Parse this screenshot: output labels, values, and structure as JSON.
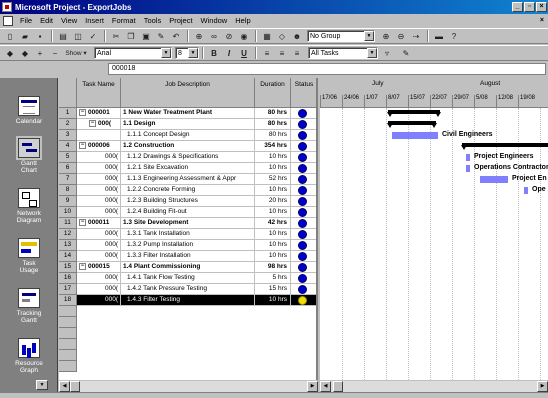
{
  "window": {
    "title": "Microsoft Project - ExportJobs",
    "minimize": "_",
    "maximize": "▫",
    "close": "×"
  },
  "menu": {
    "items": [
      {
        "label": "File"
      },
      {
        "label": "Edit"
      },
      {
        "label": "View"
      },
      {
        "label": "Insert"
      },
      {
        "label": "Format"
      },
      {
        "label": "Tools"
      },
      {
        "label": "Project"
      },
      {
        "label": "Window"
      },
      {
        "label": "Help"
      }
    ],
    "doc_close": "×"
  },
  "toolbar1": {
    "group_select": "No Group"
  },
  "toolbar2": {
    "show_label": "Show ▾",
    "font": "Arial",
    "font_size": "8",
    "bold": "B",
    "italic": "I",
    "underline": "U",
    "filter": "All Tasks"
  },
  "entry_bar": {
    "value": "000018"
  },
  "view_bar": [
    {
      "label": "Calendar",
      "icon": "calendar-icon"
    },
    {
      "label": "Gantt Chart",
      "icon": "gantt-chart-icon"
    },
    {
      "label": "Network Diagram",
      "icon": "network-diagram-icon"
    },
    {
      "label": "Task Usage",
      "icon": "task-usage-icon"
    },
    {
      "label": "Tracking Gantt",
      "icon": "tracking-gantt-icon"
    },
    {
      "label": "Resource Graph",
      "icon": "resource-graph-icon"
    }
  ],
  "table": {
    "columns": [
      "Task Name",
      "Job Description",
      "Duration",
      "Status"
    ],
    "rows": [
      {
        "id": "1",
        "task_name": "000001",
        "desc": "1 New Water Treatment Plant",
        "duration": "80 hrs",
        "summary": true,
        "expander": "−",
        "level": 0,
        "status": "#0000cc"
      },
      {
        "id": "2",
        "task_name": "000(",
        "desc": "1.1 Design",
        "duration": "80 hrs",
        "summary": true,
        "expander": "−",
        "level": 1,
        "status": "#0000cc"
      },
      {
        "id": "3",
        "task_name": "",
        "desc": "1.1.1 Concept Design",
        "duration": "80 hrs",
        "summary": false,
        "level": 2,
        "status": "#0000cc"
      },
      {
        "id": "4",
        "task_name": "000006",
        "desc": "1.2 Construction",
        "duration": "354 hrs",
        "summary": true,
        "expander": "−",
        "level": 0,
        "status": "#0000cc"
      },
      {
        "id": "5",
        "task_name": "000(",
        "desc": "1.1.2 Drawings & Specifications",
        "duration": "10 hrs",
        "summary": false,
        "level": 2,
        "status": "#0000cc"
      },
      {
        "id": "6",
        "task_name": "000(",
        "desc": "1.2.1 Site Excavation",
        "duration": "10 hrs",
        "summary": false,
        "level": 2,
        "status": "#0000cc"
      },
      {
        "id": "7",
        "task_name": "000(",
        "desc": "1.1.3 Engineering Assessment & Appr",
        "duration": "52 hrs",
        "summary": false,
        "level": 2,
        "status": "#0000cc"
      },
      {
        "id": "8",
        "task_name": "000(",
        "desc": "1.2.2 Concrete Forming",
        "duration": "10 hrs",
        "summary": false,
        "level": 2,
        "status": "#0000cc"
      },
      {
        "id": "9",
        "task_name": "000(",
        "desc": "1.2.3 Building Structures",
        "duration": "20 hrs",
        "summary": false,
        "level": 2,
        "status": "#0000cc"
      },
      {
        "id": "10",
        "task_name": "000(",
        "desc": "1.2.4 Building Fit-out",
        "duration": "10 hrs",
        "summary": false,
        "level": 2,
        "status": "#0000cc"
      },
      {
        "id": "11",
        "task_name": "000011",
        "desc": "1.3 Site Development",
        "duration": "42 hrs",
        "summary": true,
        "expander": "−",
        "level": 0,
        "status": "#0000cc"
      },
      {
        "id": "12",
        "task_name": "000(",
        "desc": "1.3.1 Tank Installation",
        "duration": "10 hrs",
        "summary": false,
        "level": 2,
        "status": "#0000cc"
      },
      {
        "id": "13",
        "task_name": "000(",
        "desc": "1.3.2 Pump Installation",
        "duration": "10 hrs",
        "summary": false,
        "level": 2,
        "status": "#0000cc"
      },
      {
        "id": "14",
        "task_name": "000(",
        "desc": "1.3.3 Filter Installation",
        "duration": "10 hrs",
        "summary": false,
        "level": 2,
        "status": "#0000cc"
      },
      {
        "id": "15",
        "task_name": "000015",
        "desc": "1.4 Plant Commissioning",
        "duration": "98 hrs",
        "summary": true,
        "expander": "−",
        "level": 0,
        "status": "#0000cc"
      },
      {
        "id": "16",
        "task_name": "000(",
        "desc": "1.4.1 Tank Flow Testing",
        "duration": "5 hrs",
        "summary": false,
        "level": 2,
        "status": "#0000cc"
      },
      {
        "id": "17",
        "task_name": "000(",
        "desc": "1.4.2 Tank Pressure Testing",
        "duration": "15 hrs",
        "summary": false,
        "level": 2,
        "status": "#0000cc"
      },
      {
        "id": "18",
        "task_name": "000(",
        "desc": "1.4.3 Filter Testing",
        "duration": "10 hrs",
        "summary": false,
        "level": 2,
        "status": "#f0e000",
        "selected": true
      }
    ]
  },
  "timescale": {
    "months": [
      "July",
      "August"
    ],
    "weeks": [
      "17/06",
      "24/06",
      "1/07",
      "8/07",
      "15/07",
      "22/07",
      "29/07",
      "5/08",
      "12/08",
      "19/08"
    ]
  },
  "gantt_labels": {
    "civil": "Civil Engineers",
    "project": "Project Engineers",
    "operations": "Operations Contractors",
    "project2": "Project En",
    "ope": "Ope"
  },
  "colors": {
    "task_bar": "#8080ff",
    "status_ok": "#0000cc",
    "status_warn": "#f0e000"
  }
}
